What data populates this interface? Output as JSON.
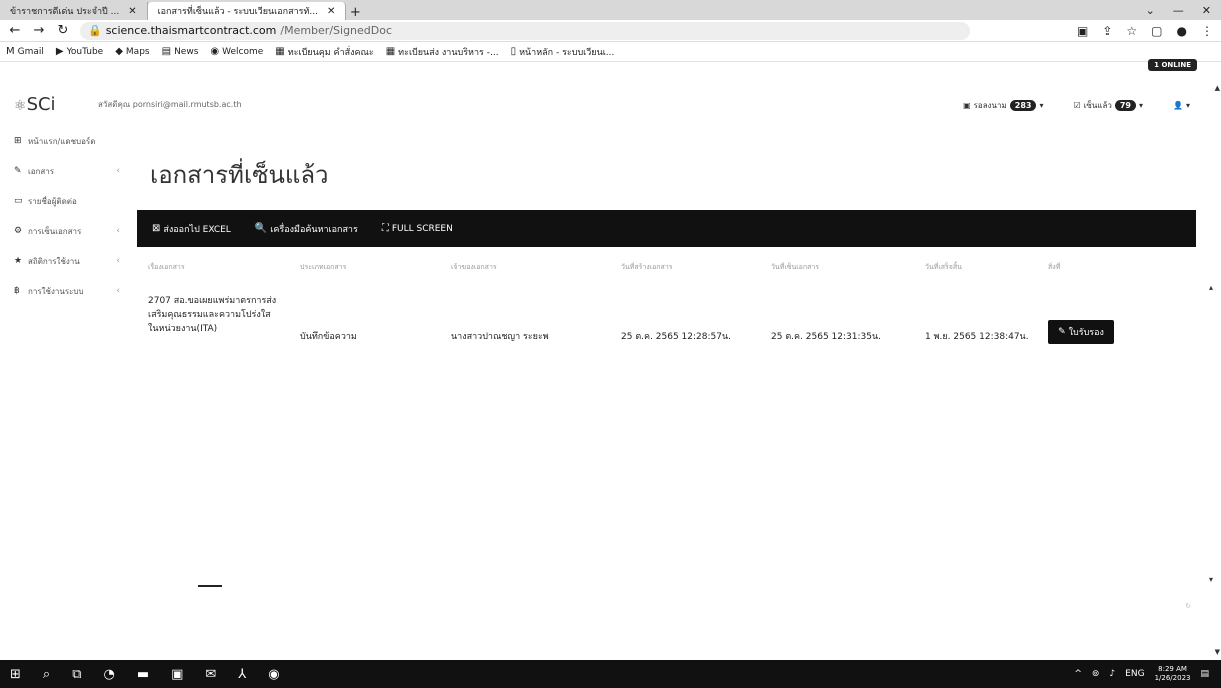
{
  "browser": {
    "tabs": [
      {
        "title": "ข้าราชการดีเด่น ประจำปี ...",
        "active": false
      },
      {
        "title": "เอกสารที่เซ็นแล้ว - ระบบเวียนเอกสารทั...",
        "active": true
      }
    ],
    "url_host": "science.thaismartcontract.com",
    "url_path": "/Member/SignedDoc",
    "bookmarks": [
      "Gmail",
      "YouTube",
      "Maps",
      "News",
      "Welcome",
      "ทะเบียนคุม คำสั่งคณะ",
      "ทะเบียนส่ง งานบริหาร -...",
      "หน้าหลัก - ระบบเวียนเ..."
    ]
  },
  "header": {
    "logo": "SCi",
    "welcome": "สวัสดีคุณ pornsiri@mail.rmutsb.ac.th",
    "pending_label": "รอลงนาม",
    "pending_count": "283",
    "signed_label": "เซ็นแล้ว",
    "signed_count": "79",
    "online": "1 ONLINE"
  },
  "sidebar": {
    "items": [
      {
        "label": "หน้าแรก/แดชบอร์ด",
        "icon": "dashboard-icon"
      },
      {
        "label": "เอกสาร",
        "icon": "edit-icon"
      },
      {
        "label": "รายชื่อผู้ติดต่อ",
        "icon": "contact-icon"
      },
      {
        "label": "การเซ็นเอกสาร",
        "icon": "sign-icon"
      },
      {
        "label": "สถิติการใช้งาน",
        "icon": "star-icon"
      },
      {
        "label": "การใช้งานระบบ",
        "icon": "bitcoin-icon"
      }
    ]
  },
  "main": {
    "title": "เอกสารที่เซ็นแล้ว",
    "toolbar": {
      "export": "ส่งออกไป EXCEL",
      "search": "เครื่องมือค้นหาเอกสาร",
      "fullscreen": "FULL SCREEN"
    },
    "columns": [
      "เรื่องเอกสาร",
      "ประเภทเอกสาร",
      "เจ้าของเอกสาร",
      "วันที่สร้างเอกสาร",
      "วันที่เซ็นเอกสาร",
      "วันที่เสร็จสิ้น",
      "สิ่งที่"
    ],
    "rows": [
      {
        "subject": "2707 สอ.ขอเผยแพร่มาตรการส่งเสริมคุณธรรมและความโปร่งใสในหน่วยงาน(ITA)",
        "type": "บันทึกข้อความ",
        "owner": "นางสาวปาณชญา ระยะพ",
        "created": "25 ต.ค. 2565 12:28:57น.",
        "signed": "25 ต.ค. 2565 12:31:35น.",
        "completed": "1 พ.ย. 2565 12:38:47น.",
        "action": "ใบรับรอง"
      }
    ]
  },
  "taskbar": {
    "lang": "ENG",
    "time": "8:29 AM",
    "date": "1/26/2023"
  }
}
